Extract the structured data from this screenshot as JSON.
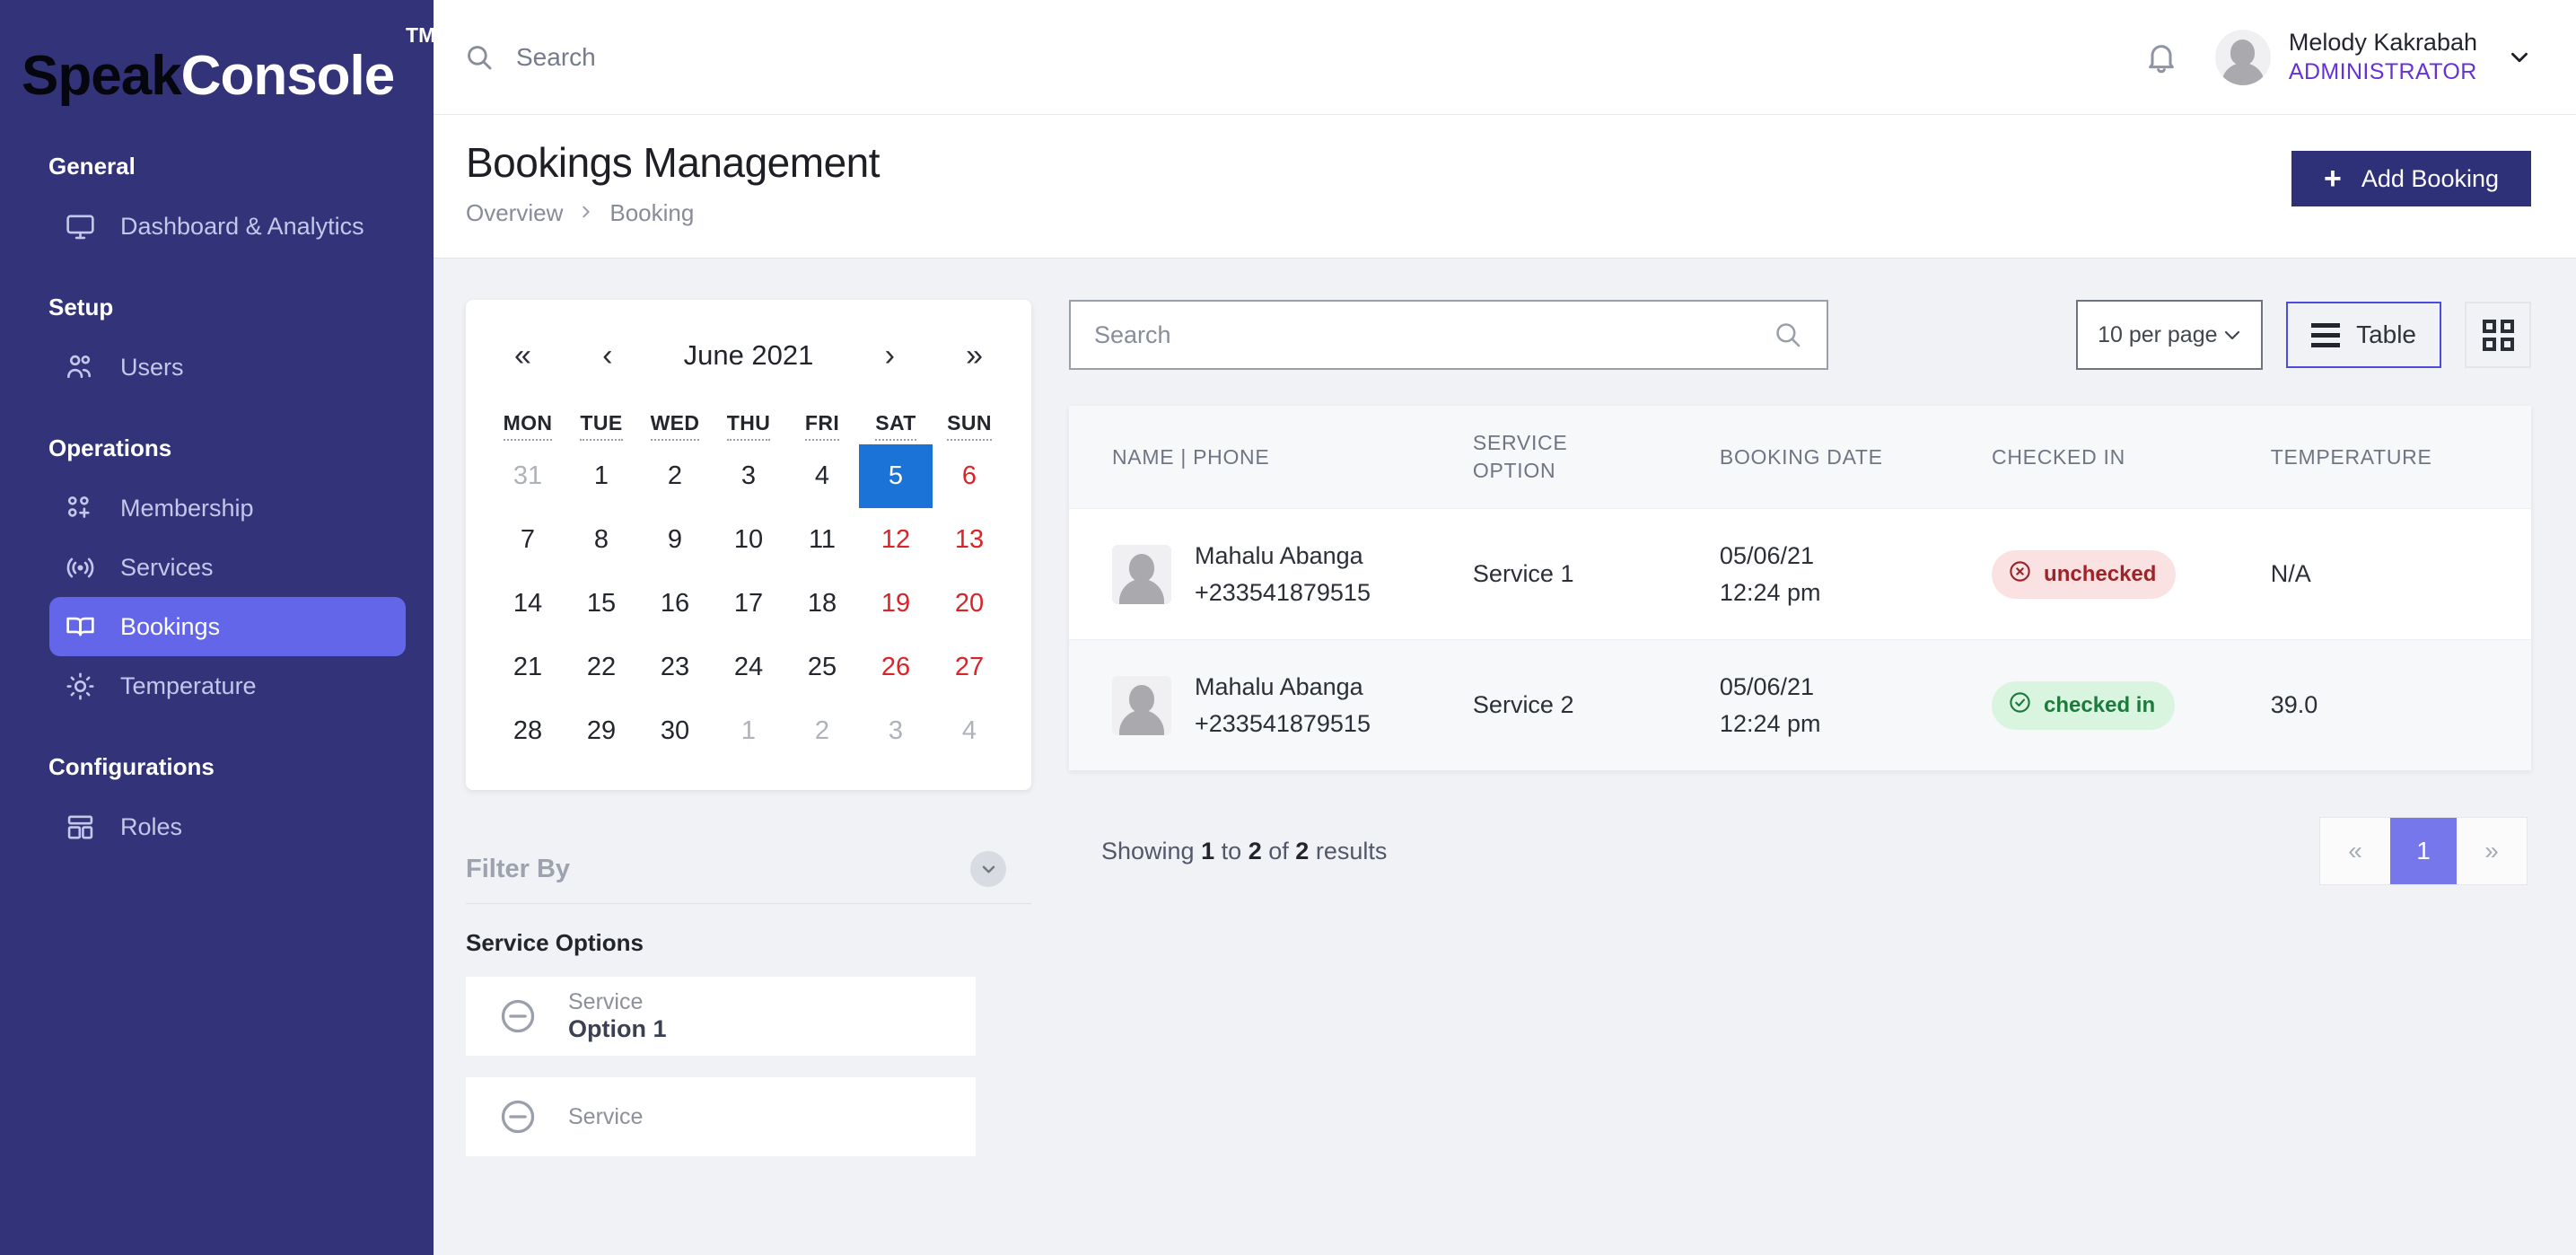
{
  "brand": {
    "name_dark": "Speak",
    "name_light": "Console",
    "tm": "TM"
  },
  "sidebar": {
    "sections": [
      {
        "title": "General",
        "items": [
          {
            "label": "Dashboard & Analytics",
            "icon": "monitor-icon",
            "active": false
          }
        ]
      },
      {
        "title": "Setup",
        "items": [
          {
            "label": "Users",
            "icon": "users-icon",
            "active": false
          }
        ]
      },
      {
        "title": "Operations",
        "items": [
          {
            "label": "Membership",
            "icon": "membership-icon",
            "active": false
          },
          {
            "label": "Services",
            "icon": "broadcast-icon",
            "active": false
          },
          {
            "label": "Bookings",
            "icon": "book-icon",
            "active": true
          },
          {
            "label": "Temperature",
            "icon": "sun-icon",
            "active": false
          }
        ]
      },
      {
        "title": "Configurations",
        "items": [
          {
            "label": "Roles",
            "icon": "layout-icon",
            "active": false
          }
        ]
      }
    ]
  },
  "topbar": {
    "search_placeholder": "Search",
    "user_name": "Melody Kakrabah",
    "user_role": "ADMINISTRATOR"
  },
  "page": {
    "title": "Bookings Management",
    "breadcrumb": [
      "Overview",
      "Booking"
    ],
    "add_button": "Add Booking",
    "add_button_icon": "+"
  },
  "calendar": {
    "month_label": "June 2021",
    "nav": {
      "first": "«",
      "prev": "‹",
      "next": "›",
      "last": "»"
    },
    "dow": [
      "MON",
      "TUE",
      "WED",
      "THU",
      "FRI",
      "SAT",
      "SUN"
    ],
    "weeks": [
      [
        {
          "d": "31",
          "t": "muted"
        },
        {
          "d": "1",
          "t": "norm"
        },
        {
          "d": "2",
          "t": "norm"
        },
        {
          "d": "3",
          "t": "norm"
        },
        {
          "d": "4",
          "t": "norm"
        },
        {
          "d": "5",
          "t": "sel"
        },
        {
          "d": "6",
          "t": "weekend"
        }
      ],
      [
        {
          "d": "7",
          "t": "norm"
        },
        {
          "d": "8",
          "t": "norm"
        },
        {
          "d": "9",
          "t": "norm"
        },
        {
          "d": "10",
          "t": "norm"
        },
        {
          "d": "11",
          "t": "norm"
        },
        {
          "d": "12",
          "t": "weekend"
        },
        {
          "d": "13",
          "t": "weekend"
        }
      ],
      [
        {
          "d": "14",
          "t": "norm"
        },
        {
          "d": "15",
          "t": "norm"
        },
        {
          "d": "16",
          "t": "norm"
        },
        {
          "d": "17",
          "t": "norm"
        },
        {
          "d": "18",
          "t": "norm"
        },
        {
          "d": "19",
          "t": "weekend"
        },
        {
          "d": "20",
          "t": "weekend"
        }
      ],
      [
        {
          "d": "21",
          "t": "norm"
        },
        {
          "d": "22",
          "t": "norm"
        },
        {
          "d": "23",
          "t": "norm"
        },
        {
          "d": "24",
          "t": "norm"
        },
        {
          "d": "25",
          "t": "norm"
        },
        {
          "d": "26",
          "t": "weekend"
        },
        {
          "d": "27",
          "t": "weekend"
        }
      ],
      [
        {
          "d": "28",
          "t": "norm"
        },
        {
          "d": "29",
          "t": "norm"
        },
        {
          "d": "30",
          "t": "norm"
        },
        {
          "d": "1",
          "t": "muted"
        },
        {
          "d": "2",
          "t": "muted"
        },
        {
          "d": "3",
          "t": "muted"
        },
        {
          "d": "4",
          "t": "muted"
        }
      ]
    ],
    "selected_day": "5"
  },
  "filter": {
    "title": "Filter By",
    "toggle_icon": "chevron-down-icon",
    "group_label": "Service Options",
    "cards": [
      {
        "caption": "Service",
        "value": "Option 1",
        "icon": "minus-circle-icon"
      },
      {
        "caption": "Service",
        "value": "",
        "icon": "minus-circle-icon"
      }
    ]
  },
  "toolbar": {
    "search_placeholder": "Search",
    "search_icon": "search-icon",
    "per_page": "10 per page",
    "table_button": "Table",
    "grid_button_icon": "grid-icon"
  },
  "table": {
    "columns": [
      "NAME | PHONE",
      "SERVICE OPTION",
      "BOOKING DATE",
      "CHECKED IN",
      "TEMPERATURE"
    ],
    "column_lines": [
      [
        "NAME | PHONE"
      ],
      [
        "SERVICE",
        "OPTION"
      ],
      [
        "BOOKING DATE"
      ],
      [
        "CHECKED IN"
      ],
      [
        "TEMPERATURE"
      ]
    ],
    "rows": [
      {
        "name": "Mahalu Abanga",
        "phone": "+233541879515",
        "service_option": "Service 1",
        "date": "05/06/21",
        "time": "12:24 pm",
        "status": "unchecked",
        "status_kind": "red",
        "status_icon": "x-circle-icon",
        "temperature": "N/A"
      },
      {
        "name": "Mahalu Abanga",
        "phone": "+233541879515",
        "service_option": "Service 2",
        "date": "05/06/21",
        "time": "12:24 pm",
        "status": "checked in",
        "status_kind": "green",
        "status_icon": "check-circle-icon",
        "temperature": "39.0"
      }
    ]
  },
  "pagination": {
    "showing_word": "Showing",
    "from": "1",
    "to_word": "to",
    "to": "2",
    "of_word": "of",
    "total": "2",
    "results_word": "results",
    "first_icon": "«",
    "current_page": "1",
    "last_icon": "»"
  },
  "colors": {
    "sidebar": "#33337a",
    "accent": "#6366e8",
    "brand_dark": "#2e3078",
    "role_purple": "#6632d6",
    "calendar_selected": "#1b73d8",
    "weekend_red": "#d9252a",
    "badge_red_text": "#9e2227",
    "badge_green_text": "#1d7a3c"
  }
}
